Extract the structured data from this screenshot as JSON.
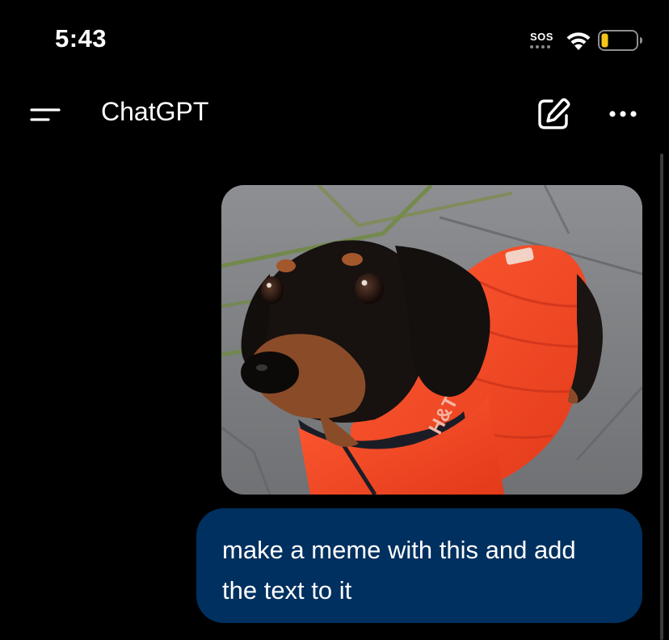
{
  "status_bar": {
    "time": "5:43",
    "sos": "SOS",
    "battery_color": "#f5c518",
    "icons": [
      "wifi-icon",
      "battery-icon"
    ]
  },
  "nav": {
    "title": "ChatGPT",
    "icons": [
      "menu-icon",
      "new-chat-icon",
      "more-icon"
    ]
  },
  "conversation": {
    "messages": [
      {
        "role": "user",
        "type": "image",
        "text_on_image": "H&T"
      },
      {
        "role": "user",
        "type": "text",
        "text": "make a meme with this and add the text to it"
      }
    ]
  },
  "colors": {
    "background": "#000000",
    "user_bubble": "#00305f",
    "text": "#ffffff"
  }
}
